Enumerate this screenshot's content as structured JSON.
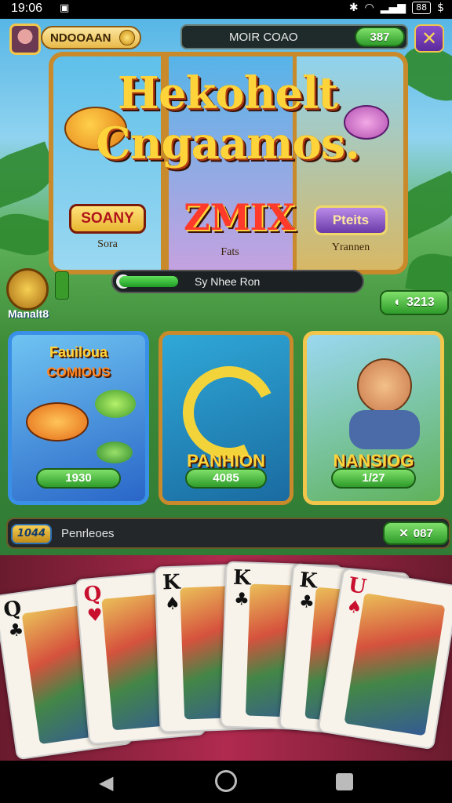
{
  "status_bar": {
    "time": "19:06",
    "battery": "88"
  },
  "top_bar": {
    "player_name": "NDOOAAN",
    "title": "MOIR COAO",
    "balance": "387"
  },
  "hero": {
    "title_line1": "Hekohelt",
    "title_line2": "Cngaamos.",
    "left_button": "SOANY",
    "left_sub": "Sora",
    "center_label": "ZMIX",
    "center_sub": "Fats",
    "right_button": "Pteits",
    "right_sub": "Yrannen"
  },
  "progress": {
    "text": "Sy Nhee Ron",
    "fraction": 0.25
  },
  "side_badge": "Manalt8",
  "score_badge": "3213",
  "games": [
    {
      "title_top": "Fauiloua",
      "title_bottom": "COMIOUS",
      "value": "1930"
    },
    {
      "title": "PANHION",
      "value": "4085"
    },
    {
      "title": "NANSIOG",
      "value": "1/27"
    }
  ],
  "info_bar": {
    "badge": "1044",
    "text": "Penrleoes",
    "value": "087"
  },
  "cards": [
    {
      "rank": "Q",
      "suit": "♣",
      "color": "#111111"
    },
    {
      "rank": "Q",
      "suit": "♥",
      "color": "#c8102e"
    },
    {
      "rank": "K",
      "suit": "♠",
      "color": "#111111"
    },
    {
      "rank": "K",
      "suit": "♣",
      "color": "#111111"
    },
    {
      "rank": "K",
      "suit": "♣",
      "color": "#111111"
    },
    {
      "rank": "U",
      "suit": "♠",
      "color": "#c8102e"
    }
  ]
}
